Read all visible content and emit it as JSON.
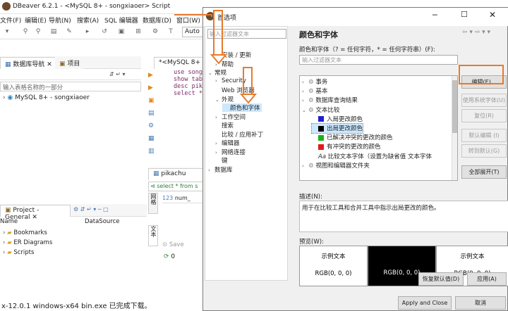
{
  "app": {
    "title": "DBeaver 6.2.1 - <MySQL 8+ - songxiaoer> Script",
    "menu": [
      "文件(F)",
      "编辑(E)",
      "导航(N)",
      "搜索(A)",
      "SQL 编辑器",
      "数据库(D)",
      "窗口(W)"
    ],
    "toolbar_combo": "Auto",
    "nav_tabs": [
      "数据库导航",
      "项目"
    ],
    "nav_filter_placeholder": "输入表格名称的一部分",
    "connection": "MySQL 8+ - songxiaoer",
    "editor_tab": "*<MySQL 8+",
    "sql_lines": [
      "use song",
      "show tab",
      "desc pik",
      "select *"
    ],
    "result_tab": "pikachu",
    "result_query": "select * from s",
    "result_col": "num_",
    "result_side_tab": "网格",
    "result_side_tab2": "文本",
    "save_label": "Save",
    "count": "0",
    "project_tab": "Project - General",
    "project_cols": [
      "Name",
      "DataSource"
    ],
    "project_items": [
      "Bookmarks",
      "ER Diagrams",
      "Scripts"
    ],
    "status_text": "x-12.0.1 windows-x64 bin.exe 已完成下载。"
  },
  "dialog": {
    "title": "首选项",
    "filter_placeholder": "输入过滤器文本",
    "tree": [
      {
        "label": "安装 / 更新",
        "depth": 1,
        "twisty": ">"
      },
      {
        "label": "帮助",
        "depth": 1,
        "twisty": ">"
      },
      {
        "label": "常规",
        "depth": 0,
        "twisty": "v"
      },
      {
        "label": "Security",
        "depth": 1,
        "twisty": ">"
      },
      {
        "label": "Web 浏览器",
        "depth": 1,
        "twisty": ""
      },
      {
        "label": "外观",
        "depth": 1,
        "twisty": "v"
      },
      {
        "label": "颜色和字体",
        "depth": 2,
        "twisty": "",
        "selected": true
      },
      {
        "label": "工作空间",
        "depth": 1,
        "twisty": ">"
      },
      {
        "label": "搜索",
        "depth": 1,
        "twisty": ""
      },
      {
        "label": "比较 / 应用补丁",
        "depth": 1,
        "twisty": ""
      },
      {
        "label": "编辑器",
        "depth": 1,
        "twisty": ">"
      },
      {
        "label": "网络连接",
        "depth": 1,
        "twisty": ">"
      },
      {
        "label": "键",
        "depth": 1,
        "twisty": ""
      },
      {
        "label": "数据库",
        "depth": 0,
        "twisty": ">"
      }
    ],
    "page_title": "颜色和字体",
    "hint": "颜色和字体（? = 任何字符，* = 任何字符串）(F):",
    "filter2_placeholder": "输入过滤器文本",
    "list": [
      {
        "label": "事务",
        "depth": 0,
        "twisty": ">",
        "icon": "folder"
      },
      {
        "label": "基本",
        "depth": 0,
        "twisty": ">",
        "icon": "folder"
      },
      {
        "label": "数据库查询结果",
        "depth": 0,
        "twisty": ">",
        "icon": "folder"
      },
      {
        "label": "文本比较",
        "depth": 0,
        "twisty": "v",
        "icon": "folder"
      },
      {
        "label": "入局更改颜色",
        "depth": 1,
        "twisty": "",
        "color": "#1f1fd6"
      },
      {
        "label": "出局更改颜色",
        "depth": 1,
        "twisty": "",
        "color": "#000000",
        "selected": true
      },
      {
        "label": "已解决冲突的更改的颜色",
        "depth": 1,
        "twisty": "",
        "color": "#19b319"
      },
      {
        "label": "有冲突的更改的颜色",
        "depth": 1,
        "twisty": "",
        "color": "#e01b1b"
      },
      {
        "label": "比较文本字体（设置为缺省值  文本字体",
        "depth": 1,
        "twisty": "",
        "icon": "font"
      },
      {
        "label": "视图和编辑器文件夹",
        "depth": 0,
        "twisty": ">",
        "icon": "folder"
      }
    ],
    "buttons": [
      {
        "label": "编辑(E)...",
        "disabled": false
      },
      {
        "label": "使用系统字体(U)",
        "disabled": true
      },
      {
        "label": "复位(R)",
        "disabled": true
      },
      {
        "label": "默认编辑 (I)",
        "disabled": true
      },
      {
        "label": "转到默认(G)",
        "disabled": true
      },
      {
        "label": "全部展开(T)",
        "disabled": false
      }
    ],
    "desc_label": "描述(N):",
    "desc_text": "用于在比较工具和合并工具中指示出局更改的颜色。",
    "preview_label": "预览(W):",
    "preview": [
      {
        "sample": "示例文本",
        "rgb": "RGB(0, 0, 0)"
      },
      {
        "sample": "",
        "rgb": "RGB(0, 0, 0)"
      },
      {
        "sample": "示例文本",
        "rgb": "RGB(0, 0, 0)"
      }
    ],
    "restore_default": "恢复默认值(D)",
    "apply": "应用(A)",
    "apply_close": "Apply and Close",
    "cancel": "取消"
  }
}
